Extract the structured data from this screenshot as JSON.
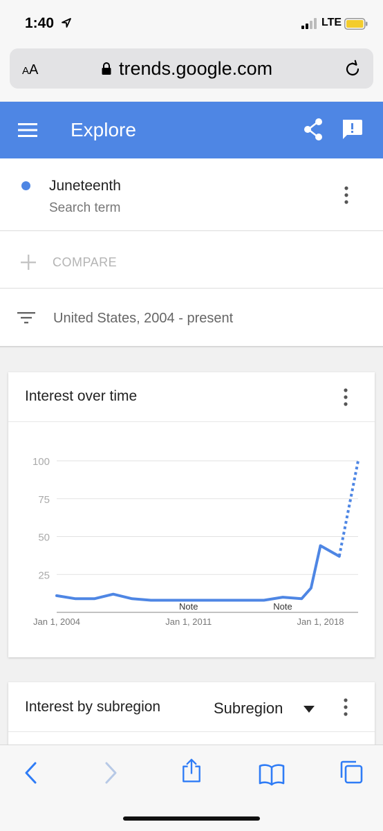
{
  "status_bar": {
    "time": "1:40",
    "network": "LTE"
  },
  "browser": {
    "text_size_label_big": "A",
    "text_size_label_small": "A",
    "url": "trends.google.com"
  },
  "app_bar": {
    "title": "Explore"
  },
  "search_term": {
    "name": "Juneteenth",
    "type": "Search term",
    "color": "#4e86e4"
  },
  "compare": {
    "label": "COMPARE"
  },
  "filter": {
    "label": "United States, 2004 - present"
  },
  "interest_over_time": {
    "title": "Interest over time",
    "notes": [
      "Note",
      "Note"
    ]
  },
  "interest_by_subregion": {
    "title": "Interest by subregion",
    "dropdown_value": "Subregion"
  },
  "chart_data": {
    "type": "line",
    "title": "Interest over time",
    "x_tick_labels": [
      "Jan 1, 2004",
      "Jan 1, 2011",
      "Jan 1, 2018"
    ],
    "y_tick_labels": [
      "25",
      "50",
      "75",
      "100"
    ],
    "ylim": [
      0,
      100
    ],
    "xlim": [
      2004,
      2020
    ],
    "grid": true,
    "series": [
      {
        "color": "#4e86e4",
        "solid": {
          "x": [
            2004,
            2005,
            2006,
            2007,
            2008,
            2009,
            2010,
            2011,
            2012,
            2013,
            2014,
            2015,
            2016,
            2017,
            2017.5,
            2018,
            2019
          ],
          "y": [
            11,
            9,
            9,
            12,
            9,
            8,
            8,
            8,
            8,
            8,
            8,
            8,
            10,
            9,
            16,
            44,
            37
          ]
        },
        "partial": {
          "x": [
            2019,
            2020
          ],
          "y": [
            37,
            100
          ]
        }
      }
    ]
  }
}
